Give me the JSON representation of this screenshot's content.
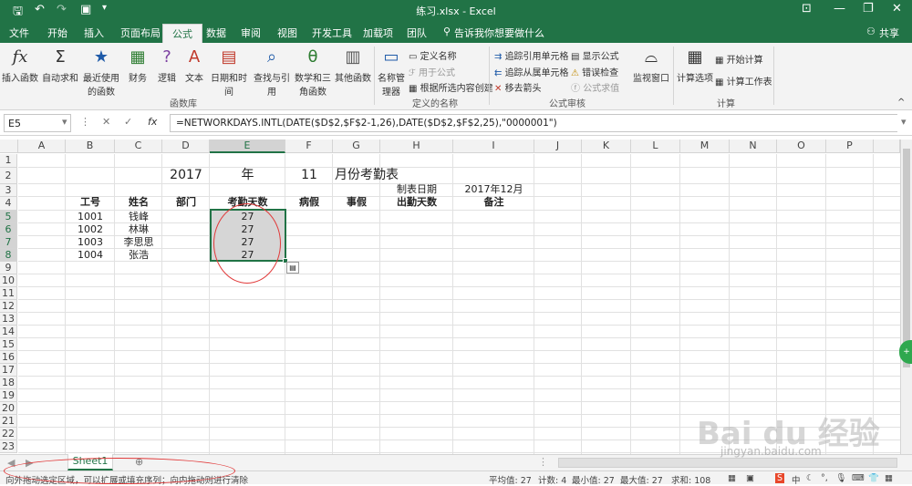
{
  "app": {
    "title": "练习.xlsx - Excel",
    "user": "共享"
  },
  "qat": {
    "save_icon": "save-icon",
    "undo_icon": "undo-icon",
    "redo_icon": "redo-icon"
  },
  "tabs": [
    "文件",
    "开始",
    "插入",
    "页面布局",
    "公式",
    "数据",
    "审阅",
    "视图",
    "开发工具",
    "加载项",
    "团队"
  ],
  "active_tab": "公式",
  "tell_me": "告诉我你想要做什么",
  "ribbon": {
    "insert_function": "插入函数",
    "autosum": "自动求和",
    "recent": "最近使用的函数",
    "financial": "财务",
    "logical": "逻辑",
    "text": "文本",
    "datetime": "日期和时间",
    "lookup": "查找与引用",
    "math": "数学和三角函数",
    "more": "其他函数",
    "group_library": "函数库",
    "name_manager": "名称管理器",
    "define_name": "定义名称",
    "use_in_formula": "用于公式",
    "create_from_selection": "根据所选内容创建",
    "group_names": "定义的名称",
    "trace_precedents": "追踪引用单元格",
    "trace_dependents": "追踪从属单元格",
    "remove_arrows": "移去箭头",
    "show_formulas": "显示公式",
    "error_checking": "错误检查",
    "evaluate_formula": "公式求值",
    "group_auditing": "公式审核",
    "watch_window": "监视窗口",
    "calc_options": "计算选项",
    "calc_now": "开始计算",
    "calc_sheet": "计算工作表",
    "group_calc": "计算"
  },
  "formula_bar": {
    "name_box": "E5",
    "fx": "fx",
    "formula": "=NETWORKDAYS.INTL(DATE($D$2,$F$2-1,26),DATE($D$2,$F$2,25),\"0000001\")"
  },
  "columns": [
    "A",
    "B",
    "C",
    "D",
    "E",
    "F",
    "G",
    "H",
    "I",
    "J",
    "K",
    "L",
    "M",
    "N",
    "O",
    "P"
  ],
  "rows": [
    "1",
    "2",
    "3",
    "4",
    "5",
    "6",
    "7",
    "8",
    "9",
    "10",
    "11",
    "12",
    "13",
    "14",
    "15",
    "16",
    "17",
    "18",
    "19",
    "20",
    "21",
    "22",
    "23"
  ],
  "sheet": {
    "title_year": "2017",
    "title_year_label": "年",
    "title_month": "11",
    "title_month_label": "月份考勤表",
    "date_label": "制表日期",
    "date_value": "2017年12月",
    "headers": [
      "工号",
      "姓名",
      "部门",
      "考勤天数",
      "病假",
      "事假",
      "出勤天数",
      "备注"
    ],
    "records": [
      {
        "id": "1001",
        "name": "钱峰",
        "days": "27"
      },
      {
        "id": "1002",
        "name": "林琳",
        "days": "27"
      },
      {
        "id": "1003",
        "name": "李思思",
        "days": "27"
      },
      {
        "id": "1004",
        "name": "张浩",
        "days": "27"
      }
    ]
  },
  "sheet_tab": "Sheet1",
  "status": {
    "hint": "向外拖动选定区域，可以扩展或填充序列；向内拖动则进行清除",
    "average": "平均值: 27",
    "count": "计数: 4",
    "min": "最小值: 27",
    "max": "最大值: 27",
    "sum": "求和: 108"
  },
  "watermark": {
    "text": "Bai du 经验",
    "url": "jingyan.baidu.com"
  }
}
